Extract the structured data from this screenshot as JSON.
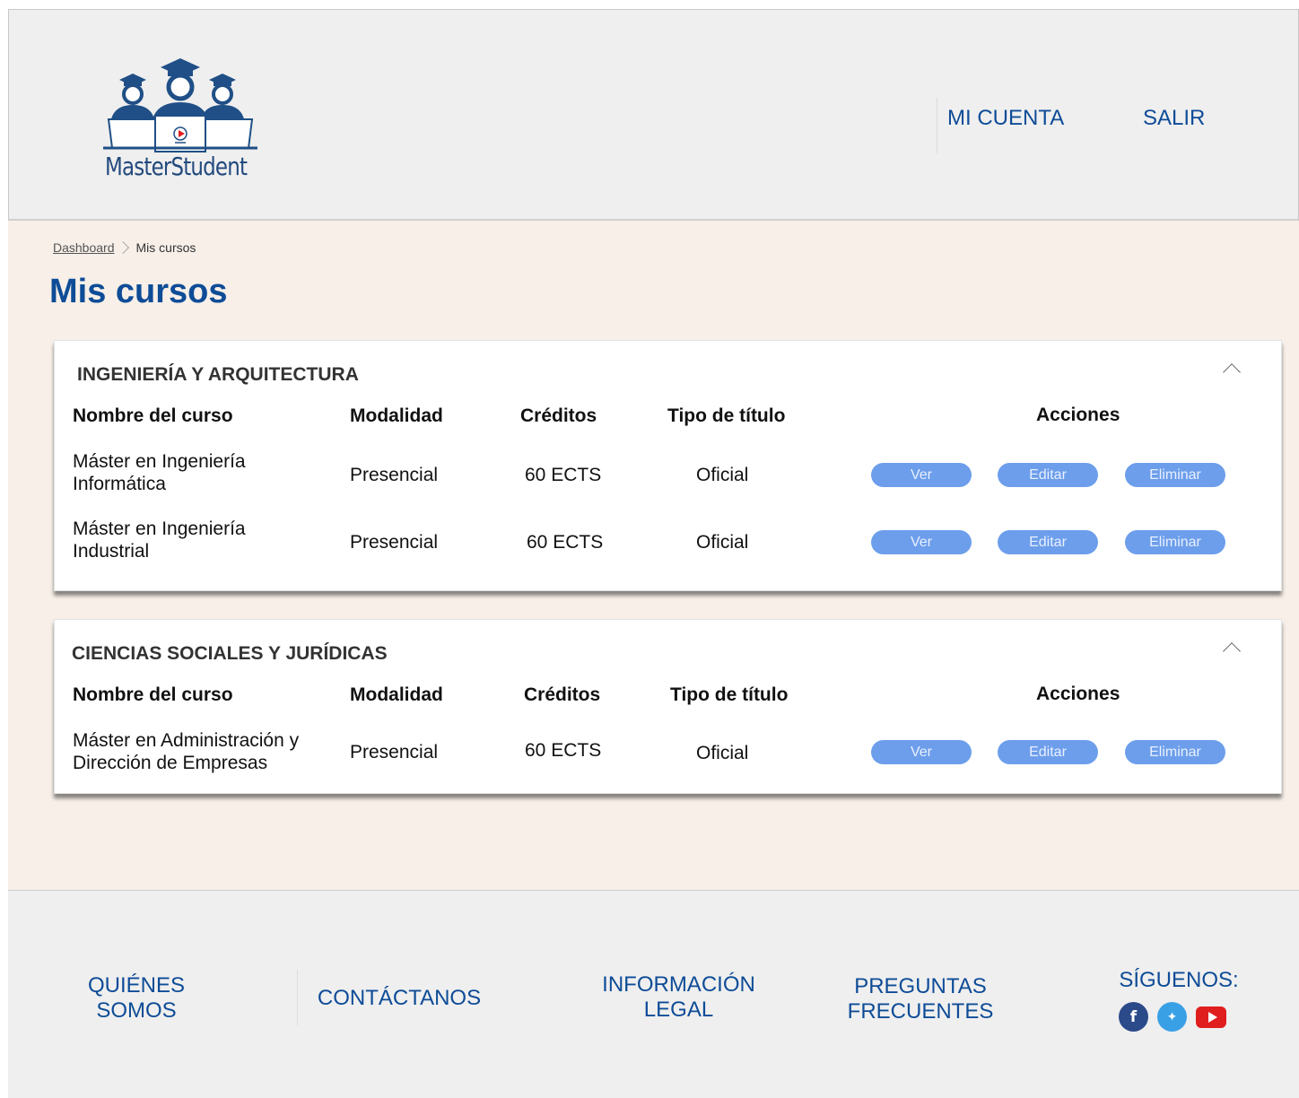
{
  "header": {
    "logo_text": "MasterStudent",
    "nav": {
      "account": "MI CUENTA",
      "logout": "SALIR"
    }
  },
  "breadcrumb": {
    "root": "Dashboard",
    "current": "Mis cursos"
  },
  "page_title": "Mis cursos",
  "columns": {
    "name": "Nombre del curso",
    "mode": "Modalidad",
    "credits": "Créditos",
    "degree_type": "Tipo de título",
    "actions": "Acciones"
  },
  "actions": {
    "view": "Ver",
    "edit": "Editar",
    "delete": "Eliminar"
  },
  "sections": [
    {
      "title": "INGENIERÍA Y ARQUITECTURA",
      "courses": [
        {
          "name": "Máster en Ingeniería Informática",
          "mode": "Presencial",
          "credits": "60 ECTS",
          "degree_type": "Oficial"
        },
        {
          "name": "Máster en Ingeniería Industrial",
          "mode": "Presencial",
          "credits": "60 ECTS",
          "degree_type": "Oficial"
        }
      ]
    },
    {
      "title": "CIENCIAS SOCIALES Y JURÍDICAS",
      "courses": [
        {
          "name": "Máster en Administración y Dirección de Empresas",
          "mode": "Presencial",
          "credits": "60 ECTS",
          "degree_type": "Oficial"
        }
      ]
    }
  ],
  "footer": {
    "about": "QUIÉNES SOMOS",
    "contact": "CONTÁCTANOS",
    "legal": "INFORMACIÓN LEGAL",
    "faq": "PREGUNTAS FRECUENTES",
    "follow": "SÍGUENOS:",
    "social_icons": [
      "facebook-icon",
      "twitter-icon",
      "youtube-icon"
    ]
  },
  "colors": {
    "brand_blue": "#0e4c97",
    "button_blue": "#6d9eeb",
    "main_bg": "#f7efe8",
    "header_bg": "#efefef"
  }
}
